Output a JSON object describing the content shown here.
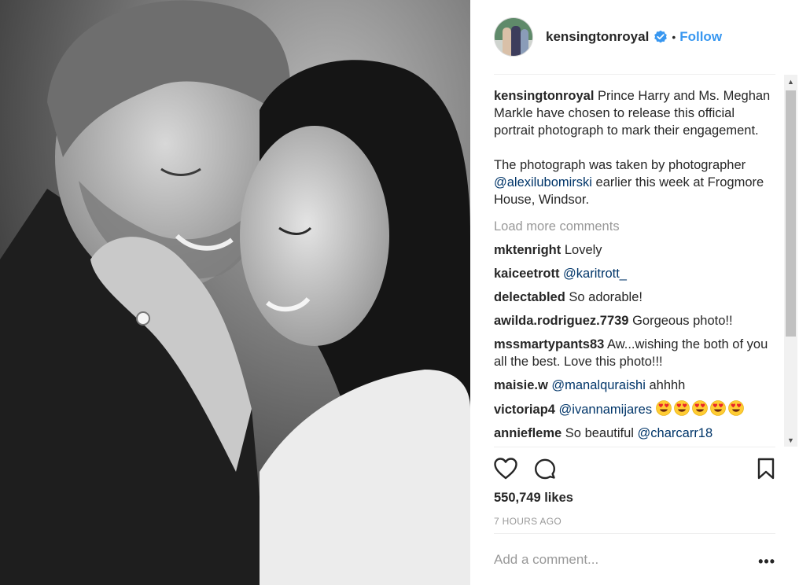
{
  "post": {
    "username": "kensingtonroyal",
    "verified": true,
    "separator": "•",
    "follow_label": "Follow",
    "photo_alt": "Portrait photograph"
  },
  "caption": {
    "username": "kensingtonroyal",
    "text_part1": "Prince Harry and Ms. Meghan Markle have chosen to release this official portrait photograph to mark their engagement.",
    "text_part2_pre": "The photograph was taken by photographer ",
    "mention": "@alexilubomirski",
    "text_part2_post": " earlier this week at Frogmore House, Windsor."
  },
  "load_more": "Load more comments",
  "comments": [
    {
      "user": "mktenright",
      "mention": "",
      "text": "Lovely"
    },
    {
      "user": "kaiceetrott",
      "mention": "@karitrott_",
      "text": ""
    },
    {
      "user": "delectabled",
      "mention": "",
      "text": "So adorable!"
    },
    {
      "user": "awilda.rodriguez.7739",
      "mention": "",
      "text": "Gorgeous photo!!"
    },
    {
      "user": "mssmartypants83",
      "mention": "",
      "text": "Aw...wishing the both of you all the best. Love this photo!!!"
    },
    {
      "user": "maisie.w",
      "mention": "@manalquraishi",
      "text": "ahhhh"
    },
    {
      "user": "victoriap4",
      "mention": "@ivannamijares",
      "text": "",
      "emoji_count": 5,
      "emoji": "heart-eyes-emoji"
    },
    {
      "user": "anniefleme",
      "mention": "@charcarr18",
      "text": "So beautiful"
    }
  ],
  "likes": "550,749 likes",
  "time": "7 HOURS AGO",
  "add_comment_placeholder": "Add a comment...",
  "more_label": "•••",
  "icons": {
    "like": "heart-outline-icon",
    "comment": "comment-bubble-icon",
    "save": "bookmark-icon",
    "verified": "verified-badge-icon"
  },
  "colors": {
    "link": "#003569",
    "follow": "#3897f0",
    "verified": "#3897f0",
    "muted": "#999999"
  }
}
